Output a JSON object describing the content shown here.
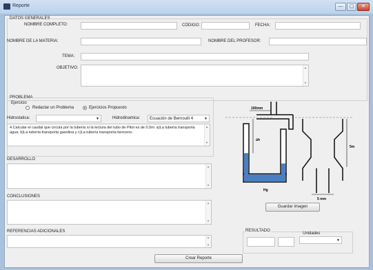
{
  "window": {
    "title": "Reporte",
    "min_glyph": "—",
    "max_glyph": "▢",
    "close_glyph": "✕"
  },
  "datos": {
    "group_label": "DATOS GENERALES",
    "nombre_label": "NOMBRE COMPLETO:",
    "codigo_label": "CÓDIGO:",
    "fecha_label": "FECHA:",
    "materia_label": "NOMBRE DE LA MATERIA:",
    "profesor_label": "NOMBRE DEL PROFESOR:",
    "tema_label": "TEMA:",
    "objetivo_label": "OBJETIVO:"
  },
  "problema": {
    "group_label": "PROBLEMA",
    "ejercicio_label": "Ejercicio",
    "radio_redactar": "Redactar un Problema",
    "radio_ejercicios": "Ejercicios Propuesto",
    "selected_radio": "ejercicios",
    "hidrostatica_label": "Hidrostatica:",
    "hidrostatica_value": "",
    "hidrodinamica_label": "Hidrodinamica:",
    "hidrodinamica_value": "Ecuación de Bernoulli 4",
    "text": "4.Calcular el caudal que circula por la tubería si la lectura del tubo de Pitot es de 0.5m: a)La tubería transporta agua. b)La tubería transporta gasolina y c)La tubería transporta benceno."
  },
  "diagram": {
    "label_100mm": "100mm",
    "label_h": "∆h",
    "label_5m": "5m",
    "label_hg": "Hg",
    "label_5mm": "5 mm"
  },
  "desarrollo": {
    "label": "DESARROLLO"
  },
  "conclusiones": {
    "label": "CONCLUSIONES"
  },
  "referencias": {
    "label": "REFERENCIAS ADICIONALES"
  },
  "resultado": {
    "label": "RESULTADO",
    "unidades_label": "Unidades",
    "unidades_value": ""
  },
  "buttons": {
    "guardar_imagen": "Guardar Imagen",
    "crear_reporte": "Crear Reporte"
  },
  "colors": {
    "liquid": "#4a7fc4",
    "tube": "#0b0b0b",
    "accent_radio": "#1f4fae",
    "frame": "#a9c1dd"
  }
}
